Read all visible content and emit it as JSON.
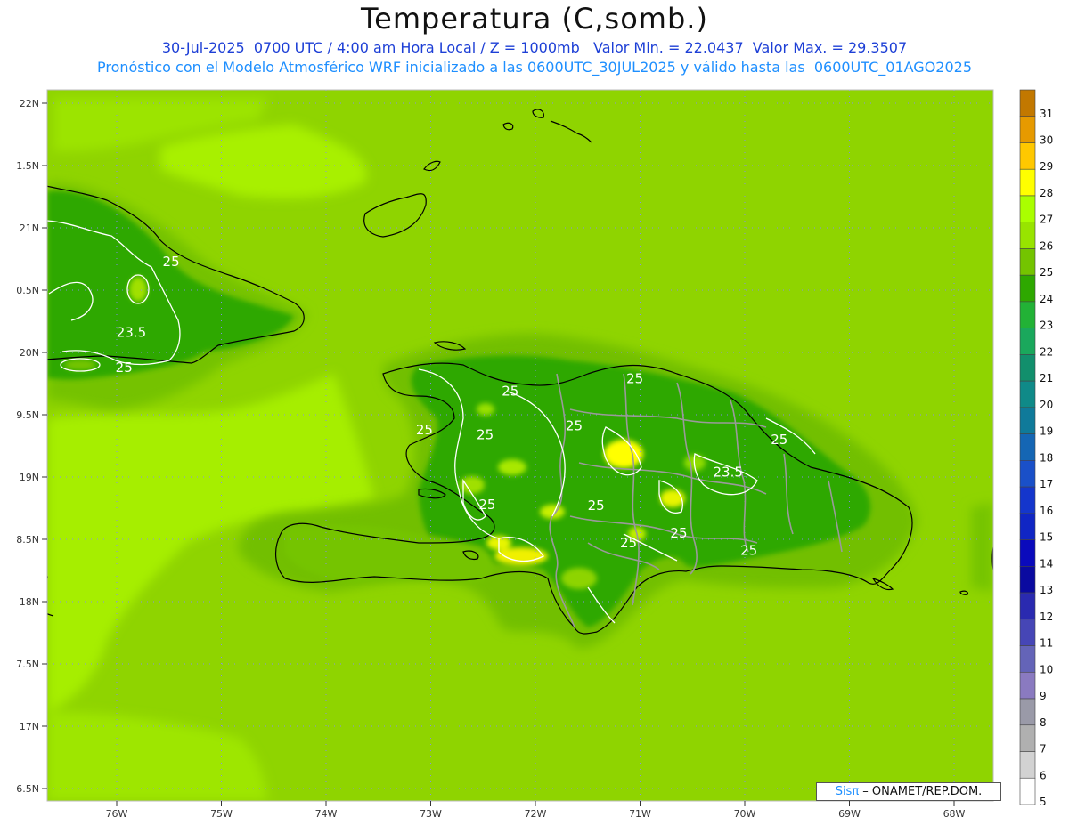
{
  "header": {
    "title": "Temperatura (C,somb.)",
    "line1": "30-Jul-2025  0700 UTC / 4:00 am Hora Local / Z = 1000mb   Valor Min. = 22.0437  Valor Max. = 29.3507",
    "line2": "Pronóstico con el Modelo Atmosférico WRF inicializado a las 0600UTC_30JUL2025 y válido hasta las  0600UTC_01AGO2025"
  },
  "axes": {
    "lat_labels": [
      "22N",
      "1.5N",
      "21N",
      "0.5N",
      "20N",
      "9.5N",
      "19N",
      "8.5N",
      "18N",
      "7.5N",
      "17N",
      "6.5N"
    ],
    "lon_labels": [
      "76W",
      "75W",
      "74W",
      "73W",
      "72W",
      "71W",
      "70W",
      "69W",
      "68W"
    ]
  },
  "contour_labels": [
    {
      "text": "25",
      "lon": -75.48,
      "lat": 20.73
    },
    {
      "text": "23.5",
      "lon": -75.86,
      "lat": 20.16
    },
    {
      "text": "25",
      "lon": -75.93,
      "lat": 19.88
    },
    {
      "text": "25",
      "lon": -72.24,
      "lat": 19.69
    },
    {
      "text": "25",
      "lon": -71.05,
      "lat": 19.79
    },
    {
      "text": "25",
      "lon": -73.06,
      "lat": 19.38
    },
    {
      "text": "25",
      "lon": -72.48,
      "lat": 19.34
    },
    {
      "text": "25",
      "lon": -71.63,
      "lat": 19.41
    },
    {
      "text": "25",
      "lon": -69.67,
      "lat": 19.3
    },
    {
      "text": "23.5",
      "lon": -70.16,
      "lat": 19.04
    },
    {
      "text": "25",
      "lon": -72.46,
      "lat": 18.78
    },
    {
      "text": "25",
      "lon": -71.42,
      "lat": 18.77
    },
    {
      "text": "25",
      "lon": -70.63,
      "lat": 18.55
    },
    {
      "text": "25",
      "lon": -71.11,
      "lat": 18.47
    },
    {
      "text": "25",
      "lon": -69.96,
      "lat": 18.41
    }
  ],
  "colorbar": {
    "levels": [
      "31",
      "30",
      "29",
      "28",
      "27",
      "26",
      "25",
      "24",
      "23",
      "22",
      "21",
      "20",
      "19",
      "18",
      "17",
      "16",
      "15",
      "14",
      "13",
      "12",
      "11",
      "10",
      "9",
      "8",
      "7",
      "6",
      "5"
    ],
    "colors": [
      "#c27800",
      "#e69a00",
      "#ffc800",
      "#ffff00",
      "#aaff00",
      "#98e400",
      "#74c400",
      "#2ea800",
      "#22b236",
      "#1aa85c",
      "#128f6c",
      "#0f8a88",
      "#0f7a9a",
      "#1566b4",
      "#1a50c8",
      "#1436cc",
      "#1026c4",
      "#0a0abc",
      "#0a0aa0",
      "#2a2ab0",
      "#4646b6",
      "#6464b8",
      "#8a7ac0",
      "#9a9aa8",
      "#b0b0b0",
      "#d2d2d2",
      "#ffffff"
    ]
  },
  "credit": {
    "sis": "Sisπ",
    "org": " – ONAMET/REP.DOM."
  }
}
